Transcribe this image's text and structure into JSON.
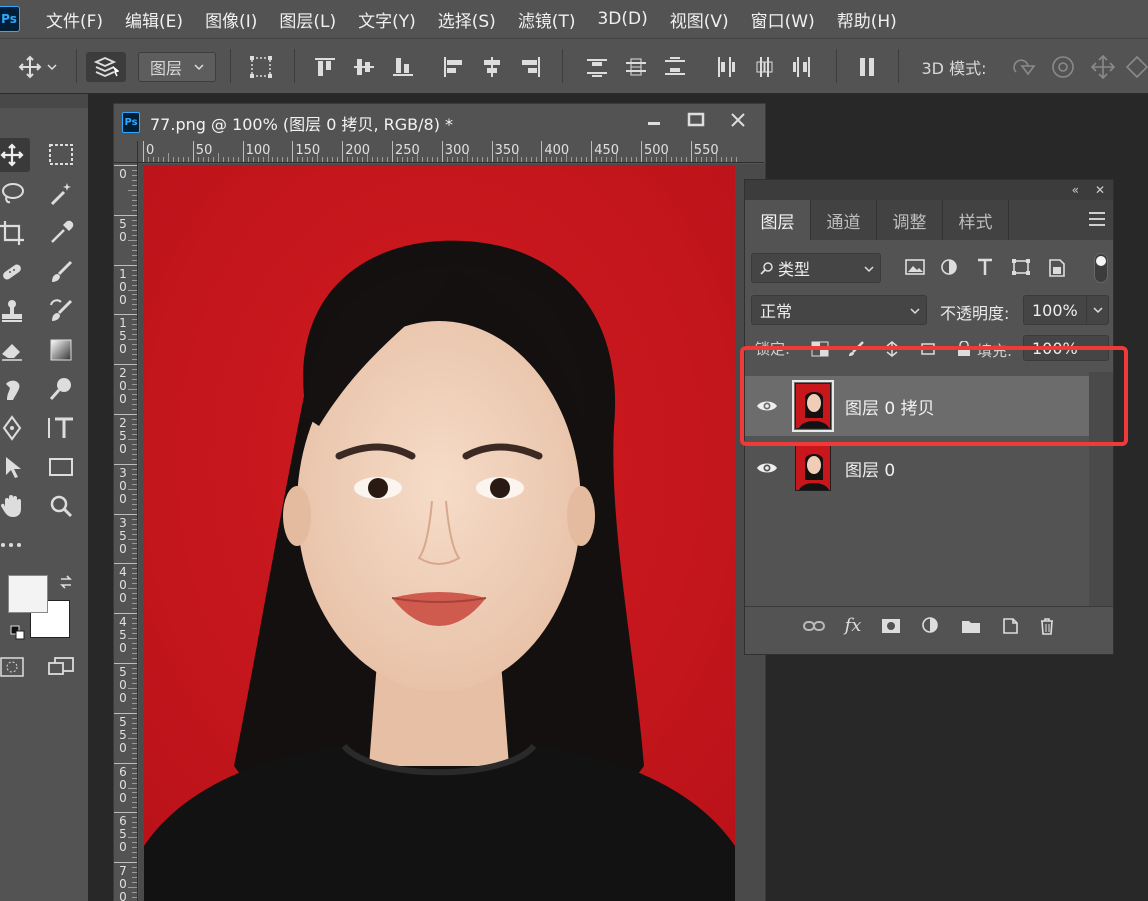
{
  "app": {
    "logo": "Ps"
  },
  "menu": [
    "文件(F)",
    "编辑(E)",
    "图像(I)",
    "图层(L)",
    "文字(Y)",
    "选择(S)",
    "滤镜(T)",
    "3D(D)",
    "视图(V)",
    "窗口(W)",
    "帮助(H)"
  ],
  "options": {
    "auto_select_value": "图层",
    "mode_label": "3D 模式:"
  },
  "document": {
    "title": "77.png @ 100% (图层 0 拷贝, RGB/8) *",
    "ruler_top": [
      "0",
      "50",
      "100",
      "150",
      "200",
      "250",
      "300",
      "350",
      "400",
      "450",
      "500",
      "550"
    ],
    "ruler_left": [
      "0",
      "50",
      "100",
      "150",
      "200",
      "250",
      "300",
      "350",
      "400",
      "450",
      "500",
      "550",
      "600",
      "650",
      "700"
    ]
  },
  "layers_panel": {
    "tabs": [
      "图层",
      "通道",
      "调整",
      "样式"
    ],
    "filter_kind": "类型",
    "blend_mode": "正常",
    "opacity_label": "不透明度:",
    "opacity_value": "100%",
    "lock_label": "锁定:",
    "fill_label": "填充:",
    "fill_value": "100%",
    "layers": [
      {
        "name": "图层 0 拷贝",
        "selected": true,
        "visible": true
      },
      {
        "name": "图层 0",
        "selected": false,
        "visible": true
      }
    ]
  },
  "colors": {
    "accent_highlight": "#f03a3a",
    "background_red": "#c8171c",
    "ps_blue": "#31a8ff"
  }
}
